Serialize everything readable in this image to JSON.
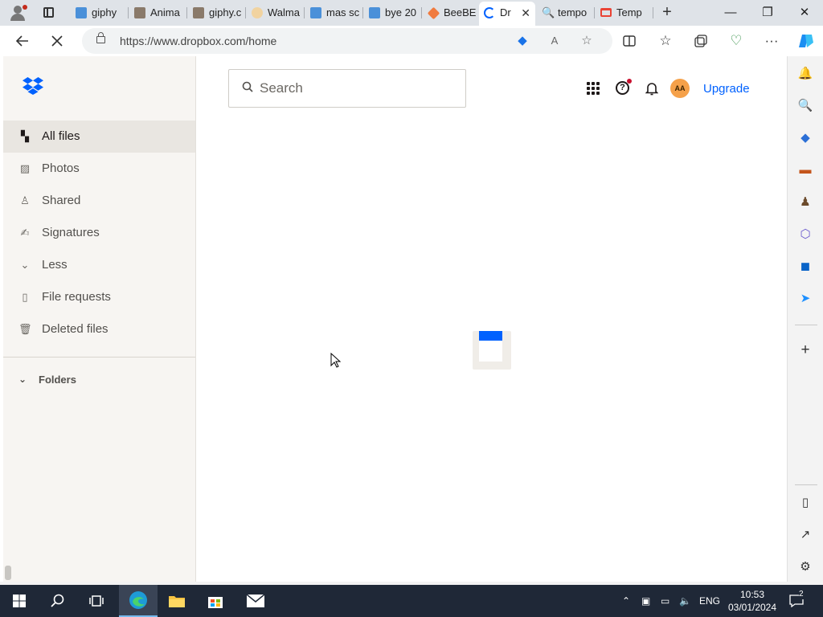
{
  "browser": {
    "tabs": [
      {
        "title": "giphy",
        "favicon_color": "#4a90d9"
      },
      {
        "title": "Anima",
        "favicon_color": "#8a7a6a"
      },
      {
        "title": "giphy.c",
        "favicon_color": "#8a7a6a"
      },
      {
        "title": "Walma",
        "favicon_color": "#f1d3a0"
      },
      {
        "title": "mas sc",
        "favicon_color": "#4a90d9"
      },
      {
        "title": "bye 20",
        "favicon_color": "#4a90d9"
      },
      {
        "title": "BeeBE",
        "favicon_color": "#f07b3f"
      },
      {
        "title": "Dr",
        "favicon_color": "#0061fe"
      },
      {
        "title": "tempo",
        "favicon_color": "#1a73e8"
      },
      {
        "title": "Temp",
        "favicon_color": "#ea4335"
      }
    ],
    "new_tab_symbol": "+",
    "window_controls": {
      "minimize": "—",
      "restore": "❐",
      "close": "✕"
    },
    "url": "https://www.dropbox.com/home"
  },
  "dropbox": {
    "search_placeholder": "Search",
    "avatar_initials": "AA",
    "upgrade_label": "Upgrade",
    "nav": [
      {
        "label": "All files",
        "icon": "folder-grid-icon",
        "selected": true
      },
      {
        "label": "Photos",
        "icon": "photo-icon"
      },
      {
        "label": "Shared",
        "icon": "people-icon"
      },
      {
        "label": "Signatures",
        "icon": "signature-icon"
      },
      {
        "label": "Less",
        "icon": "chevron-down-icon"
      },
      {
        "label": "File requests",
        "icon": "file-request-icon"
      },
      {
        "label": "Deleted files",
        "icon": "trash-icon"
      }
    ],
    "folders_label": "Folders",
    "accent": "#0061fe"
  },
  "taskbar": {
    "language": "ENG",
    "time": "10:53",
    "date": "03/01/2024",
    "notification_count": "2"
  }
}
